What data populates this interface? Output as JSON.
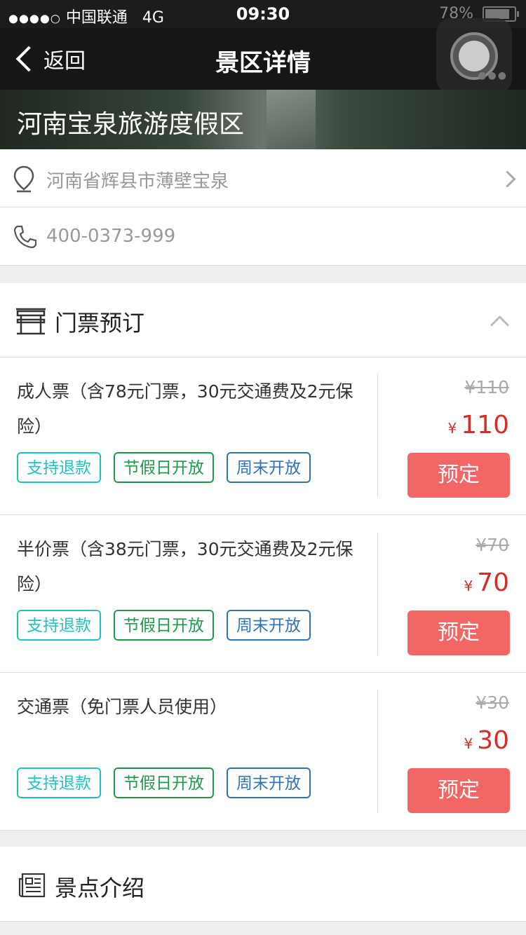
{
  "status_bar": {
    "carrier": "中国联通",
    "network": "4G",
    "time": "09:30",
    "battery": "78%"
  },
  "nav": {
    "back_label": "返回",
    "title": "景区详情"
  },
  "hero": {
    "scenic_name": "河南宝泉旅游度假区"
  },
  "info": {
    "address": "河南省辉县市薄壁宝泉",
    "phone": "400-0373-999"
  },
  "tickets_section": {
    "title": "门票预订",
    "items": [
      {
        "name": "成人票（含78元门票，30元交通费及2元保险）",
        "tags": [
          "支持退款",
          "节假日开放",
          "周末开放"
        ],
        "original_price": "¥110",
        "currency": "¥",
        "price": "110",
        "button": "预定"
      },
      {
        "name": "半价票（含38元门票，30元交通费及2元保险）",
        "tags": [
          "支持退款",
          "节假日开放",
          "周末开放"
        ],
        "original_price": "¥70",
        "currency": "¥",
        "price": "70",
        "button": "预定"
      },
      {
        "name": "交通票（免门票人员使用）",
        "tags": [
          "支持退款",
          "节假日开放",
          "周末开放"
        ],
        "original_price": "¥30",
        "currency": "¥",
        "price": "30",
        "button": "预定"
      }
    ]
  },
  "intro_section": {
    "title": "景点介绍"
  },
  "colors": {
    "price_red": "#d0302a",
    "book_button": "#f26665",
    "tag_refund": "#22c1c1",
    "tag_holiday": "#1e9a4a",
    "tag_weekend": "#2d74b4"
  },
  "icons": [
    "back-chevron-icon",
    "location-pin-icon",
    "chevron-right-icon",
    "phone-icon",
    "ticket-gate-icon",
    "chevron-up-icon",
    "newspaper-icon"
  ]
}
